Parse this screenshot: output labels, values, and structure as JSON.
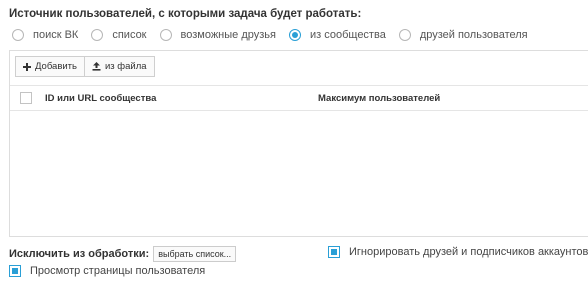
{
  "source": {
    "title": "Источник пользователей, с которыми задача будет работать:",
    "options": [
      {
        "label": "поиск ВК",
        "checked": false
      },
      {
        "label": "список",
        "checked": false
      },
      {
        "label": "возможные друзья",
        "checked": false
      },
      {
        "label": "из сообщества",
        "checked": true
      },
      {
        "label": "друзей пользователя",
        "checked": false
      }
    ]
  },
  "toolbar": {
    "add_label": "Добавить",
    "from_file_label": "из файла"
  },
  "table": {
    "columns": [
      "ID или URL сообщества",
      "Максимум пользователей"
    ],
    "rows": []
  },
  "exclude": {
    "label": "Исключить из обработки:",
    "select_button": "выбрать список..."
  },
  "options": {
    "ignore_friends_label": "Игнорировать друзей и подписчиков аккаунтов",
    "ignore_friends_checked": true,
    "view_page_label": "Просмотр страницы пользователя",
    "view_page_checked": true
  },
  "colors": {
    "accent": "#2a9fd6"
  }
}
